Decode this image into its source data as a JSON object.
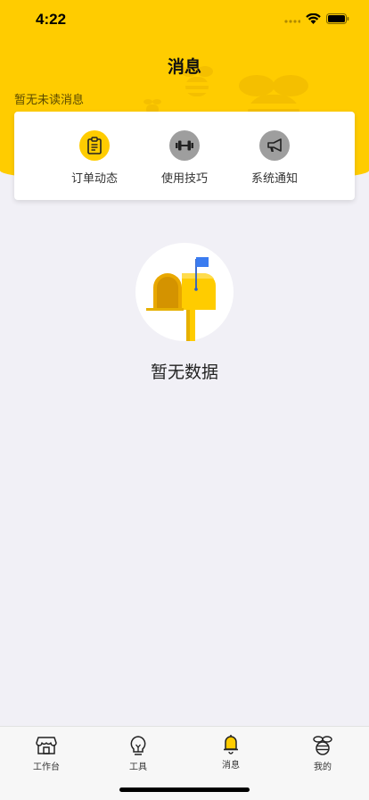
{
  "status_bar": {
    "time": "4:22"
  },
  "header": {
    "title": "消息",
    "unread_text": "暂无未读消息"
  },
  "categories": [
    {
      "label": "订单动态",
      "icon": "clipboard-icon",
      "color": "#ffcc00"
    },
    {
      "label": "使用技巧",
      "icon": "dumbbell-icon",
      "color": "#9e9e9e"
    },
    {
      "label": "系统通知",
      "icon": "megaphone-icon",
      "color": "#9e9e9e"
    }
  ],
  "empty_state": {
    "text": "暂无数据",
    "icon": "mailbox-icon"
  },
  "tabbar": {
    "items": [
      {
        "label": "工作台",
        "icon": "store-icon"
      },
      {
        "label": "工具",
        "icon": "lightbulb-icon"
      },
      {
        "label": "消息",
        "icon": "bell-icon",
        "active": true
      },
      {
        "label": "我的",
        "icon": "bee-icon"
      }
    ]
  },
  "colors": {
    "brand": "#ffcc00",
    "background": "#f1f0f6"
  }
}
